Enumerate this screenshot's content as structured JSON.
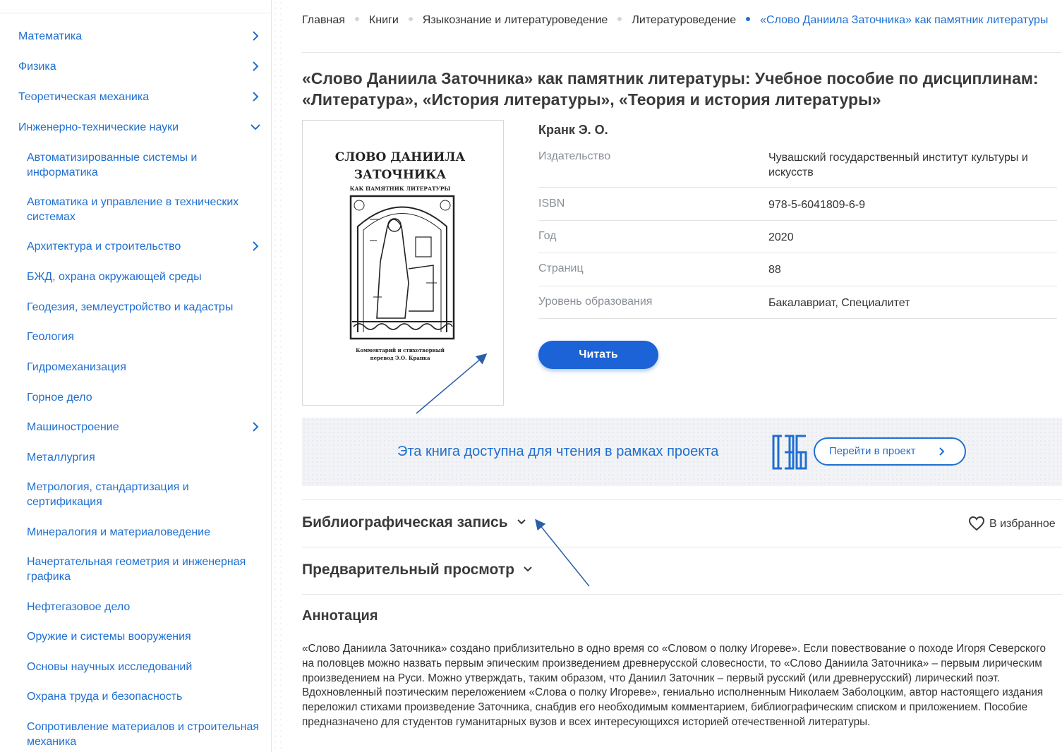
{
  "sidebar": {
    "categories": [
      {
        "label": "Математика",
        "chevron": "chevron-right-icon"
      },
      {
        "label": "Физика",
        "chevron": "chevron-right-icon"
      },
      {
        "label": "Теоретическая механика",
        "chevron": "chevron-right-icon"
      },
      {
        "label": "Инженерно-технические науки",
        "chevron": "chevron-down-icon"
      }
    ],
    "subcategories": [
      "Автоматизированные системы и информатика",
      "Автоматика и управление в технических системах",
      "Архитектура и строительство",
      "БЖД, охрана окружающей среды",
      "Геодезия, землеустройство и кадастры",
      "Геология",
      "Гидромеханизация",
      "Горное дело",
      "Машиностроение",
      "Металлургия",
      "Метрология, стандартизация и сертификация",
      "Минералогия и материаловедение",
      "Начертательная геометрия и инженерная графика",
      "Нефтегазовое дело",
      "Оружие и системы вооружения",
      "Основы научных исследований",
      "Охрана труда и безопасность",
      "Сопротивление материалов и строительная механика"
    ]
  },
  "breadcrumb": {
    "home": "Главная",
    "books": "Книги",
    "linguistics": "Языкознание и литературоведение",
    "literature": "Литературоведение",
    "current": "«Слово Даниила Заточника» как памятник литературы"
  },
  "book": {
    "title": "«Слово Даниила Заточника» как памятник литературы: Учебное пособие по дисциплинам: «Литература», «История литературы», «Теория и история литературы»",
    "author": "Кранк Э. О.",
    "cover": {
      "title_line1": "СЛОВО ДАНИИЛА",
      "title_line2": "ЗАТОЧНИКА",
      "subtitle": "КАК ПАМЯТНИК ЛИТЕРАТУРЫ",
      "footer_line1": "Комментарий и стихотворный",
      "footer_line2": "перевод Э.О. Кранка"
    },
    "meta": [
      {
        "key": "Издательство",
        "value": "Чувашский государственный институт культуры и искусств"
      },
      {
        "key": "ISBN",
        "value": "978-5-6041809-6-9"
      },
      {
        "key": "Год",
        "value": "2020"
      },
      {
        "key": "Страниц",
        "value": "88"
      },
      {
        "key": "Уровень образования",
        "value": "Бакалавриат, Специалитет"
      }
    ],
    "read_label": "Читать"
  },
  "seb_banner": {
    "text": "Эта книга доступна для чтения в рамках проекта",
    "button_label": "Перейти в проект",
    "logo_icon": "seb-logo-icon"
  },
  "sections": {
    "bibliographic": "Библиографическая запись",
    "preview": "Предварительный просмотр",
    "favorite": "В избранное",
    "annotation_heading": "Аннотация",
    "annotation_text": "«Слово Даниила Заточника» создано приблизительно в одно время со «Словом о полку Игореве». Если повествование о походе Игоря Северского на половцев можно назвать первым эпическим произведением древнерусской словесности, то «Слово Даниила Заточника» – первым лирическим произведением на Руси. Можно утверждать, таким образом, что Даниил Заточник – первый русский (или древнерусский) лирический поэт. Вдохновленный поэтическим переложением «Слова о полку Игореве», гениально исполненным Николаем Заболоцким, автор настоящего издания переложил стихами произведение Заточника, снабдив его необходимым комментарием, библиографическим списком и приложением. Пособие предназначено для студентов гуманитарных вузов и всех интересующихся историей отечественной литературы."
  },
  "colors": {
    "link": "#1f6fd0",
    "button": "#1b63d6",
    "annotation_arrow": "#2a5ea8"
  }
}
